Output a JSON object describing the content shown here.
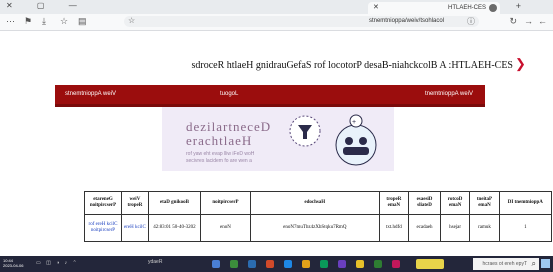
{
  "browser": {
    "tab_title": "SEC-HEALTH",
    "url": "localhost/view/appointments",
    "window_buttons": [
      "✕",
      "▢",
      "—"
    ],
    "new_tab_label": "+"
  },
  "page": {
    "title": "SEC-HEALTH: A Blockchain-Based Protocol for SafeGuarding Health Records",
    "nav": {
      "view_appointments": "View Appointments",
      "logout": "Logout",
      "view_appointment": "View Appointment"
    },
    "banner": {
      "line1": "Decentralized",
      "line2": "Healthcare",
      "tag1": "How DeFi will pave the way for",
      "tag2": "a new era of medical services"
    },
    "table": {
      "headers": [
        "Appointment ID",
        "Patient Name",
        "Doctor Name",
        "Disease Details",
        "Report Name",
        "Hashcode",
        "Prescription",
        "Booking Date",
        "View Report",
        "Generate Prescription"
      ],
      "row": {
        "id": "1",
        "patient": "kumar",
        "doctor": "rajesh",
        "disease": "headace",
        "report": "dfdh.txt",
        "hashcode": "QmR7ukqtSbXz4zbTum7None",
        "prescription": "None",
        "booking_date": "2023-04-05 10:38:24",
        "view_report": "Click Here",
        "generate": "Click Here for Prescription"
      }
    }
  },
  "taskbar": {
    "search_placeholder": "Type here to search",
    "clock_time": "10:44",
    "clock_date": "2023-04-06",
    "app_label": "Ready"
  }
}
